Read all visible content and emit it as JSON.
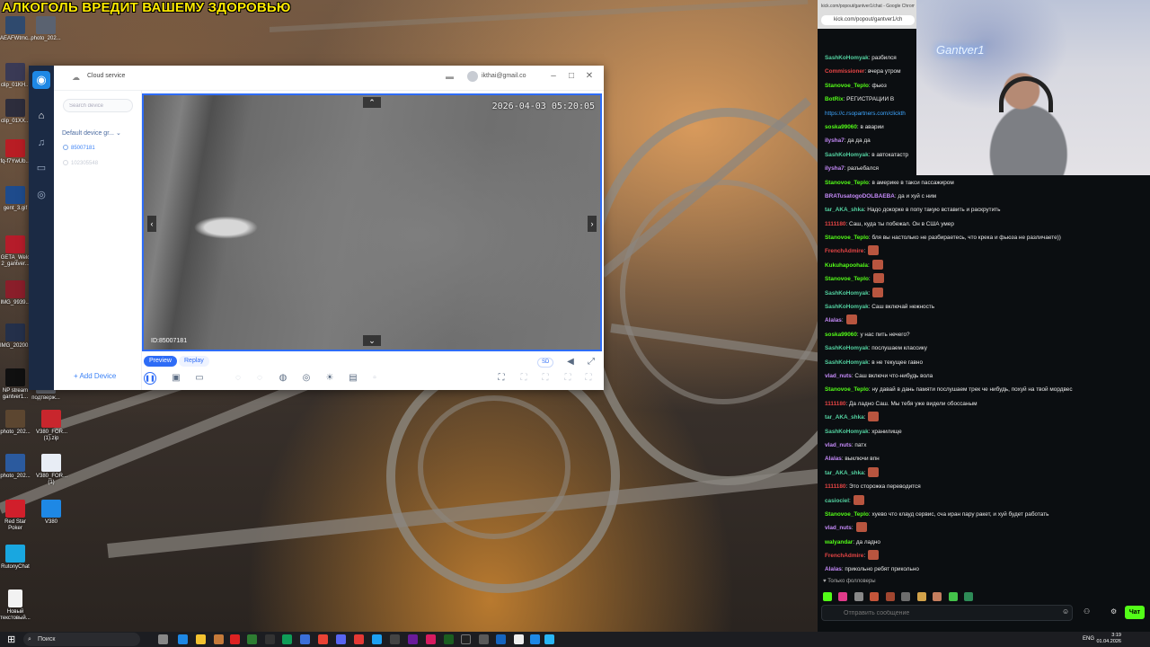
{
  "banner": "АЛКОГОЛЬ ВРЕДИТ ВАШЕМУ ЗДОРОВЬЮ",
  "desktop_icons": [
    {
      "label": "AEAFWtmc..."
    },
    {
      "label": "photo_202..."
    },
    {
      "label": "clip_01KH..."
    },
    {
      "label": "clip_01XX..."
    },
    {
      "label": "fq-f7YwUb..."
    },
    {
      "label": "gent_3.gif"
    },
    {
      "label": "GETA_Welc 2_gantver..."
    },
    {
      "label": "IMG_9939..."
    },
    {
      "label": "IMG_20200..."
    },
    {
      "label": "NP stream gantver1..."
    },
    {
      "label": "подтверж..."
    },
    {
      "label": "photo_202..."
    },
    {
      "label": "V380_FOR... (1).zip"
    },
    {
      "label": "photo_202..."
    },
    {
      "label": "V380_FOR... (1)"
    },
    {
      "label": "Red Star Poker"
    },
    {
      "label": "V380"
    },
    {
      "label": "RutonyChat"
    },
    {
      "label": "Новый текстовый..."
    }
  ],
  "app": {
    "title": "Cloud service",
    "account": "ikthai@gmail.co",
    "search_placeholder": "Search device",
    "group": "Default device gr...",
    "devices": [
      {
        "id": "85007181",
        "online": true
      },
      {
        "id": "102305548",
        "online": false
      }
    ],
    "add_device": "Add Device",
    "timestamp": "2026-04-03 05:20:05",
    "device_id_label": "ID:85007181",
    "tabs": [
      {
        "label": "Preview",
        "active": true
      },
      {
        "label": "Replay",
        "active": false
      }
    ],
    "quality": "SD",
    "accent": "#2e6cf6"
  },
  "browser": {
    "tab_title": "kick.com/popout/gantver1/chat - Google Chrome",
    "url": "kick.com/popout/gantver1/ch"
  },
  "webcam_sign": "Gantver1",
  "chat": {
    "messages": [
      {
        "user": "SashKoHomyak",
        "color": "#53d1a0",
        "text": ": разбился"
      },
      {
        "user": "Commissioner",
        "color": "#e64545",
        "text": ": вчера утром"
      },
      {
        "user": "Stanovoe_Teplo",
        "color": "#53fc18",
        "text": ": фьюз"
      },
      {
        "user": "BotRix",
        "color": "#53fc18",
        "text": ": РЕГИСТРАЦИИ В"
      },
      {
        "user": "",
        "color": "#3ea6ff",
        "text": "https://c.rsopartners.com/clickth"
      },
      {
        "user": "soska99060",
        "color": "#53fc18",
        "text": ": в аварии"
      },
      {
        "user": "ilysha7",
        "color": "#c58af9",
        "text": ": да да да"
      },
      {
        "user": "SashKoHomyak",
        "color": "#53d1a0",
        "text": ": в автокатастр"
      },
      {
        "user": "ilysha7",
        "color": "#c58af9",
        "text": ": разъебался"
      },
      {
        "user": "Stanovoe_Teplo",
        "color": "#53fc18",
        "text": ": в америке в такси пассажиром"
      },
      {
        "user": "BRATusatogoDOLBAEBA",
        "color": "#c58af9",
        "text": ": да и хуй с ним"
      },
      {
        "user": "tar_AKA_shka",
        "color": "#53d1a0",
        "text": ": Надо докорке в попу такую вставить и раскрутить"
      },
      {
        "user": "1111180",
        "color": "#e64545",
        "text": ": Саш, куда ты побежал. Он в США умер"
      },
      {
        "user": "Stanovoe_Teplo",
        "color": "#53fc18",
        "text": ": бля вы настолько не разбираетесь, что крека и фьюза не различаете))"
      },
      {
        "user": "FrenchAdmire",
        "color": "#e64545",
        "text": ":"
      },
      {
        "user": "Kukuhapoohala",
        "color": "#53fc18",
        "text": ":"
      },
      {
        "user": "Stanovoe_Teplo",
        "color": "#53fc18",
        "text": ":"
      },
      {
        "user": "SashKoHomyak",
        "color": "#53d1a0",
        "text": ":"
      },
      {
        "user": "SashKoHomyak",
        "color": "#53d1a0",
        "text": ": Саш включай нежность"
      },
      {
        "user": "Alalas",
        "color": "#c58af9",
        "text": ":"
      },
      {
        "user": "soska99060",
        "color": "#53fc18",
        "text": ": у нас пить нечего?"
      },
      {
        "user": "SashKoHomyak",
        "color": "#53d1a0",
        "text": ": послушаем классику"
      },
      {
        "user": "SashKoHomyak",
        "color": "#53d1a0",
        "text": ": в не текущее гавно"
      },
      {
        "user": "vlad_nuts",
        "color": "#c58af9",
        "text": ": Саш включи что-нибудь вола"
      },
      {
        "user": "Stanovoe_Teplo",
        "color": "#53fc18",
        "text": ": ну давай в дань памяти послушаем трек че нибудь, похуй на твой мордвес"
      },
      {
        "user": "1111180",
        "color": "#e64545",
        "text": ": Да ладно Саш. Мы тебя уже видели обоссаным"
      },
      {
        "user": "tar_AKA_shka",
        "color": "#53d1a0",
        "text": ":"
      },
      {
        "user": "SashKoHomyak",
        "color": "#53d1a0",
        "text": ": хранилище"
      },
      {
        "user": "vlad_nuts",
        "color": "#c58af9",
        "text": ": патх"
      },
      {
        "user": "Alalas",
        "color": "#c58af9",
        "text": ": выключи впн"
      },
      {
        "user": "tar_AKA_shka",
        "color": "#53d1a0",
        "text": ":"
      },
      {
        "user": "1111180",
        "color": "#e64545",
        "text": ": Это сторожка переводится"
      },
      {
        "user": "casiociel",
        "color": "#53d1a0",
        "text": ":"
      },
      {
        "user": "Stanovoe_Teplo",
        "color": "#53fc18",
        "text": ": хуево что клауд сервис, сча иран пару ракет, и хуй будет работать"
      },
      {
        "user": "vlad_nuts",
        "color": "#c58af9",
        "text": ":"
      },
      {
        "user": "walyandar",
        "color": "#53fc18",
        "text": ": да ладно"
      },
      {
        "user": "FrenchAdmire",
        "color": "#e64545",
        "text": ":"
      },
      {
        "user": "Alalas",
        "color": "#c58af9",
        "text": ": прикольно ребят прикольно"
      }
    ],
    "followers_only": "Только фолловеры",
    "input_placeholder": "Отправить сообщение",
    "send_label": "Чат"
  },
  "taskbar": {
    "search": "Поиск",
    "lang": "ENG",
    "time": "3:19",
    "date": "01.04.2026"
  }
}
